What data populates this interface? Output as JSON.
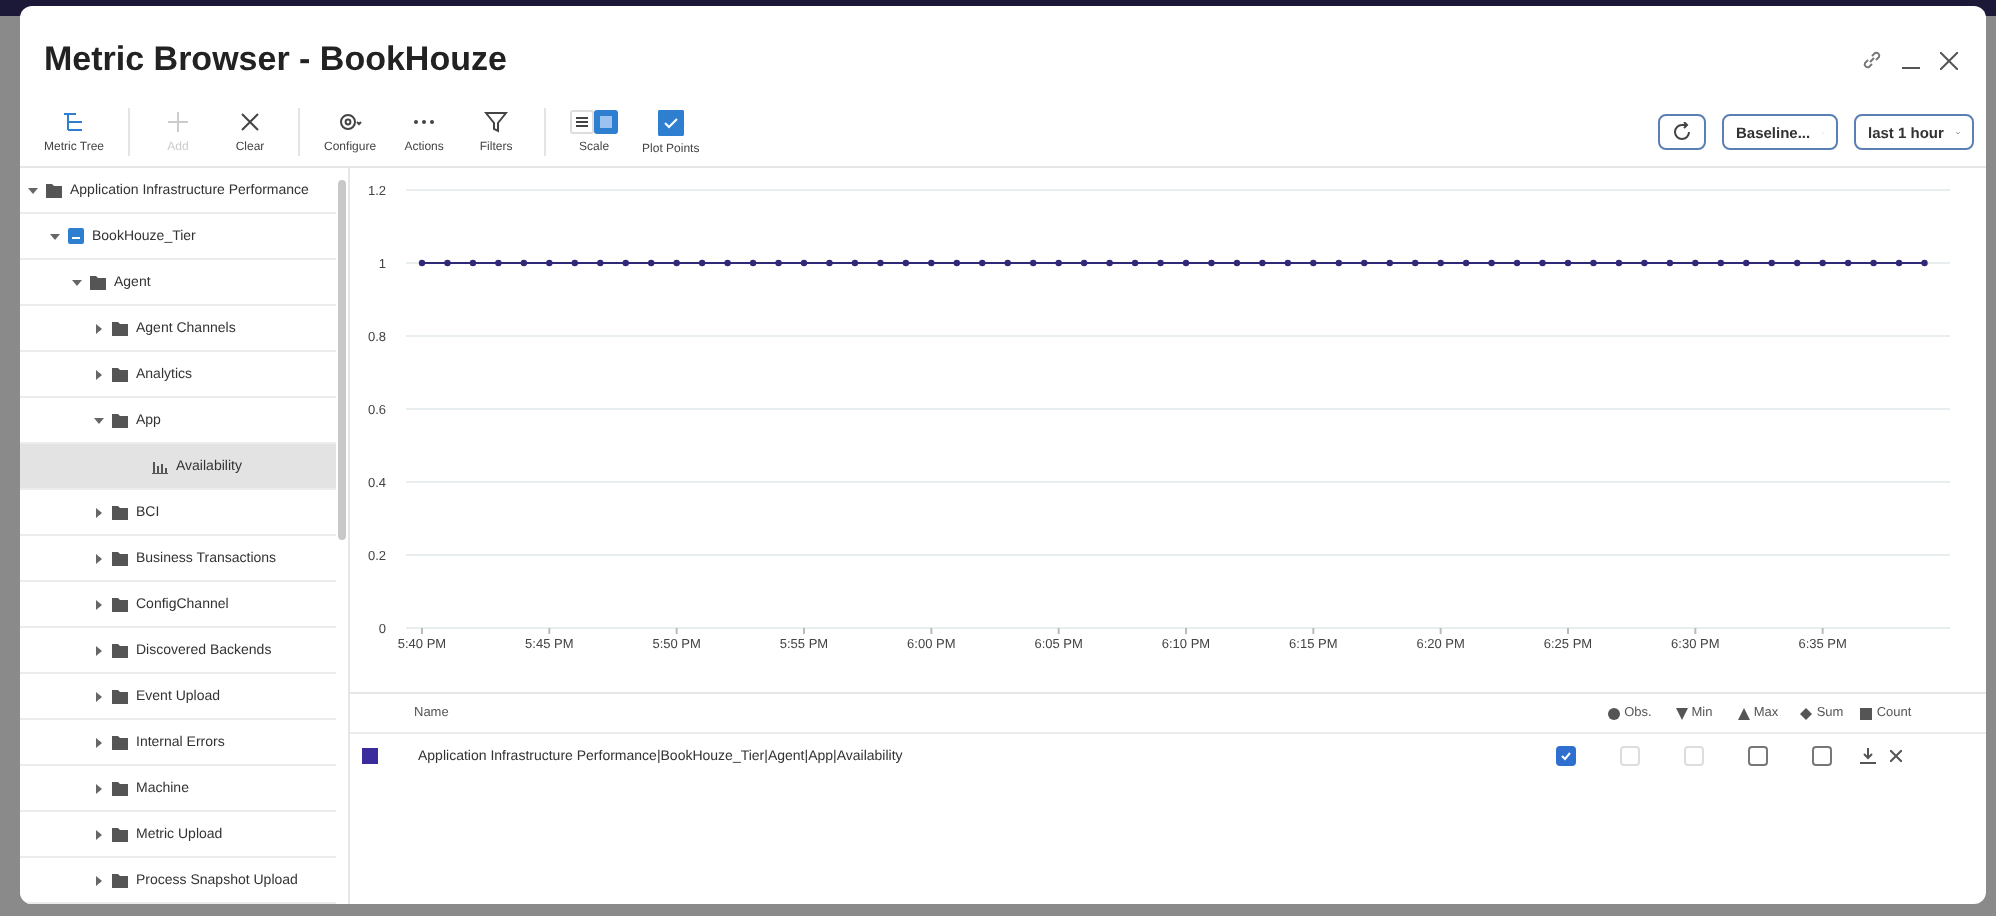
{
  "window": {
    "title": "Metric Browser - BookHouze"
  },
  "toolbar": [
    {
      "label": "Metric Tree",
      "kind": "tree",
      "disabled": false
    },
    {
      "label": "Add",
      "kind": "add",
      "disabled": true
    },
    {
      "label": "Clear",
      "kind": "clear",
      "disabled": false
    },
    {
      "label": "Configure",
      "kind": "configure",
      "disabled": false
    },
    {
      "label": "Actions",
      "kind": "actions",
      "disabled": false
    },
    {
      "label": "Filters",
      "kind": "filter",
      "disabled": false
    }
  ],
  "scale": {
    "label": "Scale",
    "options": [
      {
        "kind": "rows",
        "selected": false
      },
      {
        "kind": "square",
        "selected": true
      }
    ]
  },
  "plot_points": {
    "label": "Plot Points",
    "checked": true
  },
  "baseline": {
    "value": "Baseline..."
  },
  "time_range": {
    "value": "last 1 hour"
  },
  "tree": [
    {
      "label": "Application Infrastructure Performance",
      "kind": "folder",
      "expanded": true,
      "selected": false,
      "children": [
        {
          "label": "BookHouze_Tier",
          "kind": "tier",
          "expanded": true,
          "selected": false,
          "children": [
            {
              "label": "Agent",
              "kind": "folder",
              "expanded": true,
              "selected": false,
              "children": [
                {
                  "label": "Agent Channels",
                  "kind": "folder",
                  "expanded": false,
                  "selected": false
                },
                {
                  "label": "Analytics",
                  "kind": "folder",
                  "expanded": false,
                  "selected": false
                },
                {
                  "label": "App",
                  "kind": "folder",
                  "expanded": true,
                  "selected": false,
                  "children": [
                    {
                      "label": "Availability",
                      "kind": "metric",
                      "selected": true
                    }
                  ]
                },
                {
                  "label": "BCI",
                  "kind": "folder",
                  "expanded": false,
                  "selected": false
                },
                {
                  "label": "Business Transactions",
                  "kind": "folder",
                  "expanded": false,
                  "selected": false
                },
                {
                  "label": "ConfigChannel",
                  "kind": "folder",
                  "expanded": false,
                  "selected": false
                },
                {
                  "label": "Discovered Backends",
                  "kind": "folder",
                  "expanded": false,
                  "selected": false
                },
                {
                  "label": "Event Upload",
                  "kind": "folder",
                  "expanded": false,
                  "selected": false
                },
                {
                  "label": "Internal Errors",
                  "kind": "folder",
                  "expanded": false,
                  "selected": false
                },
                {
                  "label": "Machine",
                  "kind": "folder",
                  "expanded": false,
                  "selected": false
                },
                {
                  "label": "Metric Upload",
                  "kind": "folder",
                  "expanded": false,
                  "selected": false
                },
                {
                  "label": "Process Snapshot Upload",
                  "kind": "folder",
                  "expanded": false,
                  "selected": false
                }
              ]
            }
          ]
        }
      ]
    }
  ],
  "chart_data": {
    "type": "line",
    "categories": [
      "5:40 PM",
      null,
      null,
      null,
      null,
      "5:45 PM",
      null,
      null,
      null,
      null,
      "5:50 PM",
      null,
      null,
      null,
      null,
      "5:55 PM",
      null,
      null,
      null,
      null,
      "6:00 PM",
      null,
      null,
      null,
      null,
      "6:05 PM",
      null,
      null,
      null,
      null,
      "6:10 PM",
      null,
      null,
      null,
      null,
      "6:15 PM",
      null,
      null,
      null,
      null,
      "6:20 PM",
      null,
      null,
      null,
      null,
      "6:25 PM",
      null,
      null,
      null,
      null,
      "6:30 PM",
      null,
      null,
      null,
      null,
      "6:35 PM",
      null,
      null,
      null,
      null
    ],
    "series": [
      {
        "name": "Application Infrastructure Performance|BookHouze_Tier|Agent|App|Availability",
        "color": "#2e2a78",
        "marker": "circle",
        "values": [
          1,
          1,
          1,
          1,
          1,
          1,
          1,
          1,
          1,
          1,
          1,
          1,
          1,
          1,
          1,
          1,
          1,
          1,
          1,
          1,
          1,
          1,
          1,
          1,
          1,
          1,
          1,
          1,
          1,
          1,
          1,
          1,
          1,
          1,
          1,
          1,
          1,
          1,
          1,
          1,
          1,
          1,
          1,
          1,
          1,
          1,
          1,
          1,
          1,
          1,
          1,
          1,
          1,
          1,
          1,
          1,
          1,
          1,
          1,
          1
        ]
      }
    ],
    "grid": true,
    "ylim": [
      0,
      1.2
    ],
    "yticks": [
      0,
      0.2,
      0.4,
      0.6,
      0.8,
      1,
      1.2
    ]
  },
  "table": {
    "columns": [
      {
        "label": "Name",
        "kind": "name"
      },
      {
        "label": "Obs.",
        "kind": "obs"
      },
      {
        "label": "Min",
        "kind": "min"
      },
      {
        "label": "Max",
        "kind": "max"
      },
      {
        "label": "Sum",
        "kind": "sum"
      },
      {
        "label": "Count",
        "kind": "count"
      }
    ],
    "rows": [
      {
        "color": "#3b2c9e",
        "aggregates": [
          {
            "checked": true,
            "disabled": false
          },
          {
            "checked": false,
            "disabled": true
          },
          {
            "checked": false,
            "disabled": true
          },
          {
            "checked": false,
            "disabled": false
          },
          {
            "checked": false,
            "disabled": false
          }
        ]
      }
    ]
  }
}
